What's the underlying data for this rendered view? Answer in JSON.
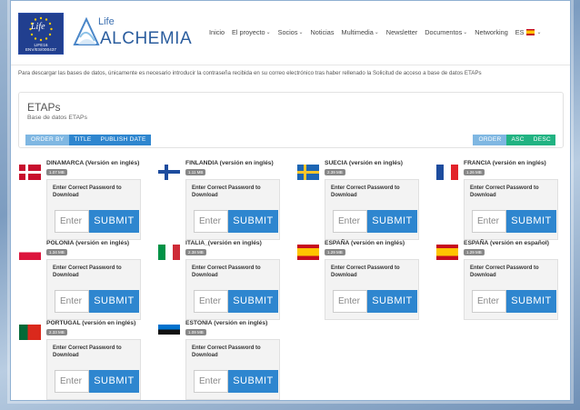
{
  "header": {
    "eu_logo_text": "Life",
    "eu_logo_code": "LIFE16 ENV/ES/000437",
    "brand_small": "Life",
    "brand_name": "ALCHEMIA",
    "nav": [
      {
        "label": "Inicio"
      },
      {
        "label": "El proyecto",
        "dropdown": true
      },
      {
        "label": "Socios",
        "dropdown": true
      },
      {
        "label": "Noticias"
      },
      {
        "label": "Multimedia",
        "dropdown": true
      },
      {
        "label": "Newsletter"
      },
      {
        "label": "Documentos",
        "dropdown": true
      },
      {
        "label": "Networking"
      },
      {
        "label": "ES",
        "dropdown": true
      }
    ]
  },
  "intro": "Para descargar las bases de datos, únicamente es necesario introducir la contraseña recibida en su correo electrónico tras haber rellenado la Solicitud de acceso a base de datos ETAPs",
  "etaps": {
    "title": "ETAPs",
    "subtitle": "Base de datos ETAPs",
    "order_by_label": "ORDER BY",
    "order_by_options": [
      "TITLE",
      "PUBLISH DATE"
    ],
    "order_label": "ORDER",
    "order_options": [
      "ASC",
      "DESC"
    ]
  },
  "password_message": "Enter Correct Password to Download",
  "password_placeholder": "Enter",
  "submit_label": "SUBMIT",
  "items": [
    {
      "title": "DINAMARCA (Versión en inglés)",
      "size": "1.07 MB",
      "flag": "denmark"
    },
    {
      "title": "FINLANDIA (versión en inglés)",
      "size": "1.11 MB",
      "flag": "finland"
    },
    {
      "title": "SUECIA (versión en inglés)",
      "size": "2.39 MB",
      "flag": "sweden"
    },
    {
      "title": "FRANCIA (versión en inglés)",
      "size": "1.26 MB",
      "flag": "france"
    },
    {
      "title": "POLONIA (versión en inglés)",
      "size": "1.34 MB",
      "flag": "poland"
    },
    {
      "title": "ITALIA_(versión en inglés)",
      "size": "2.38 MB",
      "flag": "italy"
    },
    {
      "title": "ESPAÑA (versión en inglés)",
      "size": "1.29 MB",
      "flag": "spain"
    },
    {
      "title": "ESPAÑA (versión en español)",
      "size": "1.29 MB",
      "flag": "spain"
    },
    {
      "title": "PORTUGAL (versión en inglés)",
      "size": "2.33 MB",
      "flag": "portugal"
    },
    {
      "title": "ESTONIA (versión en inglés)",
      "size": "1.09 MB",
      "flag": "estonia"
    }
  ]
}
